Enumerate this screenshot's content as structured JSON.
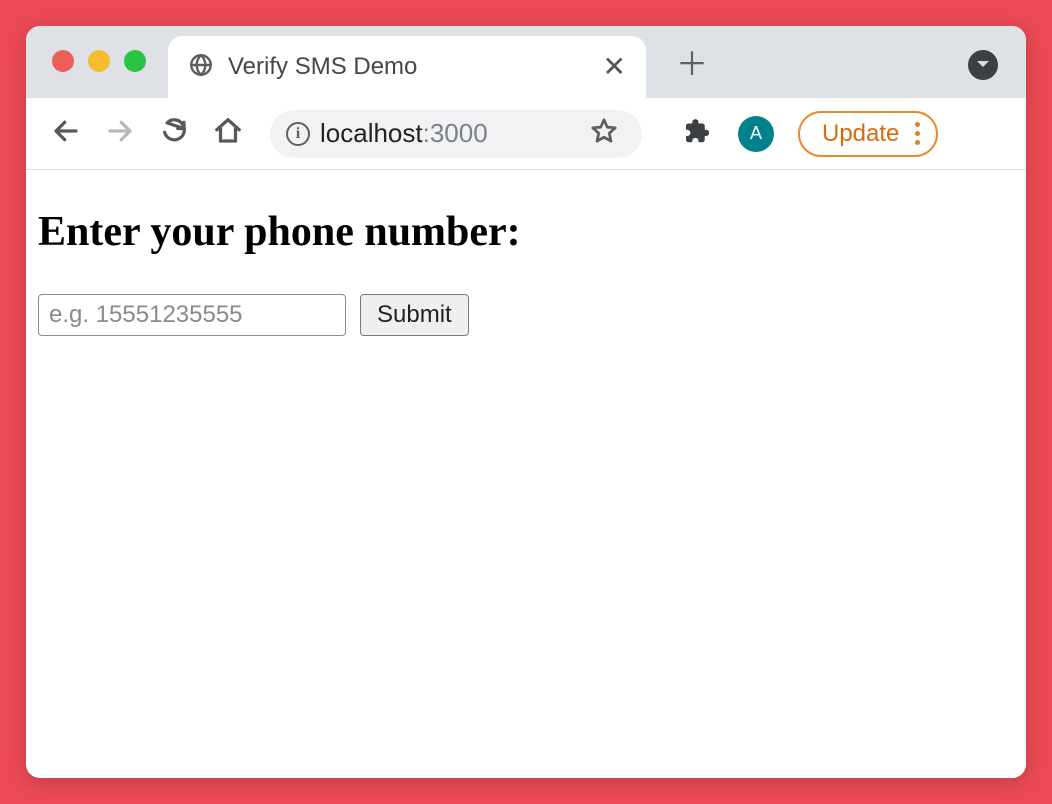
{
  "window": {
    "tab_title": "Verify SMS Demo",
    "traffic_lights": {
      "close": "#ec5f58",
      "minimize": "#f5bd30",
      "maximize": "#29c443"
    }
  },
  "toolbar": {
    "url_host": "localhost",
    "url_port": ":3000",
    "avatar_initial": "A",
    "update_label": "Update"
  },
  "page": {
    "heading": "Enter your phone number:",
    "phone_placeholder": "e.g. 15551235555",
    "phone_value": "",
    "submit_label": "Submit"
  },
  "icons": {
    "globe": "globe-icon",
    "close_tab": "close-icon",
    "new_tab": "plus-icon",
    "chrome_menu": "chevron-down-icon",
    "back": "arrow-left-icon",
    "forward": "arrow-right-icon",
    "reload": "reload-icon",
    "home": "home-icon",
    "site_info": "info-icon",
    "bookmark": "star-icon",
    "extensions": "puzzle-icon",
    "kebab": "kebab-icon"
  },
  "colors": {
    "page_bg": "#eb4a54",
    "tabstrip_bg": "#dee1e5",
    "accent_update": "#e88a25",
    "avatar_bg": "#00828c"
  }
}
